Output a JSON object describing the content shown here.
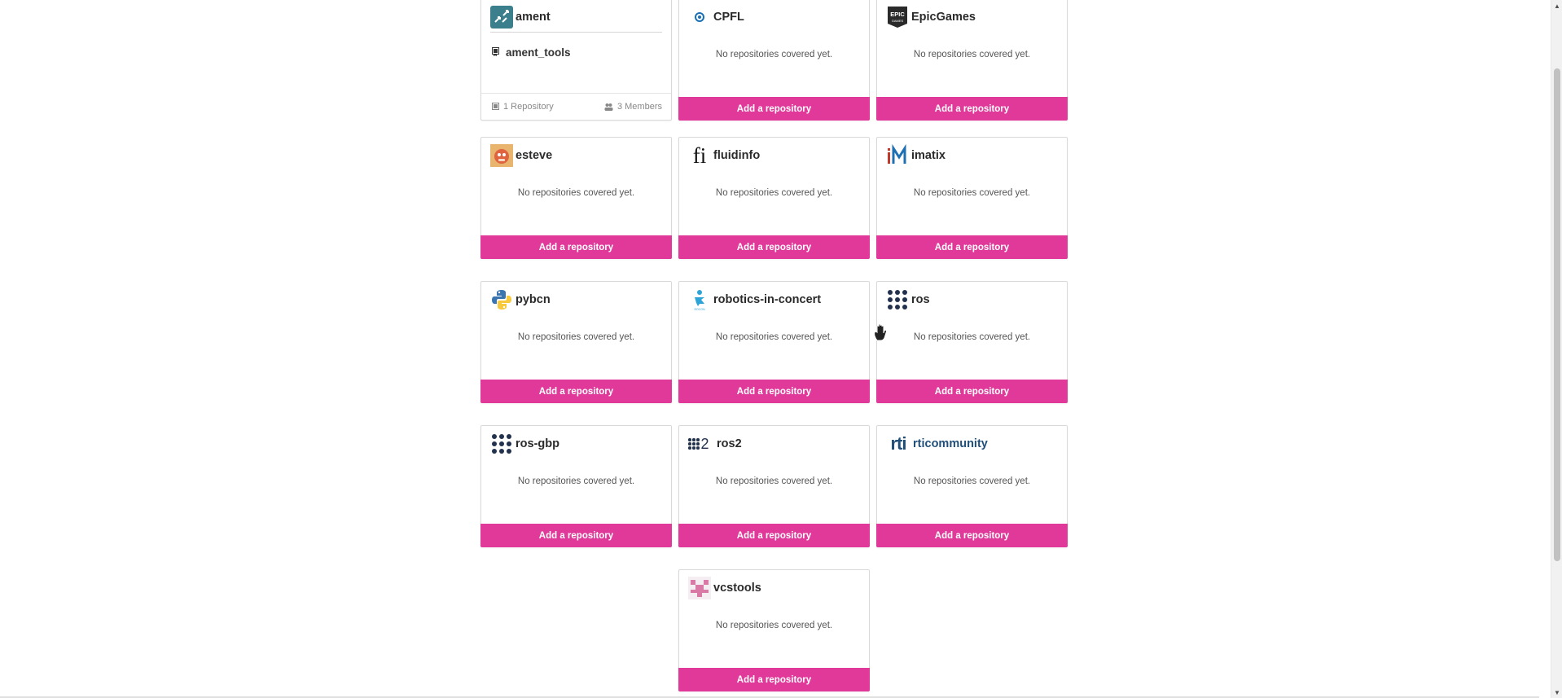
{
  "add_label": "Add a repository",
  "empty_text": "No repositories covered yet.",
  "colors": {
    "accent": "#e0399a",
    "ros_blue": "#22314e",
    "rti_blue": "#1f4e79"
  },
  "orgs": [
    {
      "name": "ament",
      "icon": "ament-logo",
      "repo": "ament_tools",
      "repo_count": "1 Repository",
      "member_count": "3 Members"
    },
    {
      "name": "CPFL",
      "icon": "cpfl-logo"
    },
    {
      "name": "EpicGames",
      "icon": "epic-games-logo",
      "logo_text": "EPIC"
    },
    {
      "name": "esteve",
      "icon": "esteve-avatar"
    },
    {
      "name": "fluidinfo",
      "icon": "fluidinfo-logo",
      "logo_text": "fi"
    },
    {
      "name": "imatix",
      "icon": "imatix-logo",
      "logo_text": "iM"
    },
    {
      "name": "pybcn",
      "icon": "python-logo"
    },
    {
      "name": "robotics-in-concert",
      "icon": "robotics-in-concert-logo"
    },
    {
      "name": "ros",
      "icon": "ros-dots-logo"
    },
    {
      "name": "ros-gbp",
      "icon": "ros-dots-logo"
    },
    {
      "name": "ros2",
      "icon": "ros2-logo",
      "logo_text": "2"
    },
    {
      "name": "rticommunity",
      "icon": "rti-logo",
      "logo_text": "rti"
    },
    {
      "name": "vcstools",
      "icon": "vcstools-identicon"
    }
  ]
}
